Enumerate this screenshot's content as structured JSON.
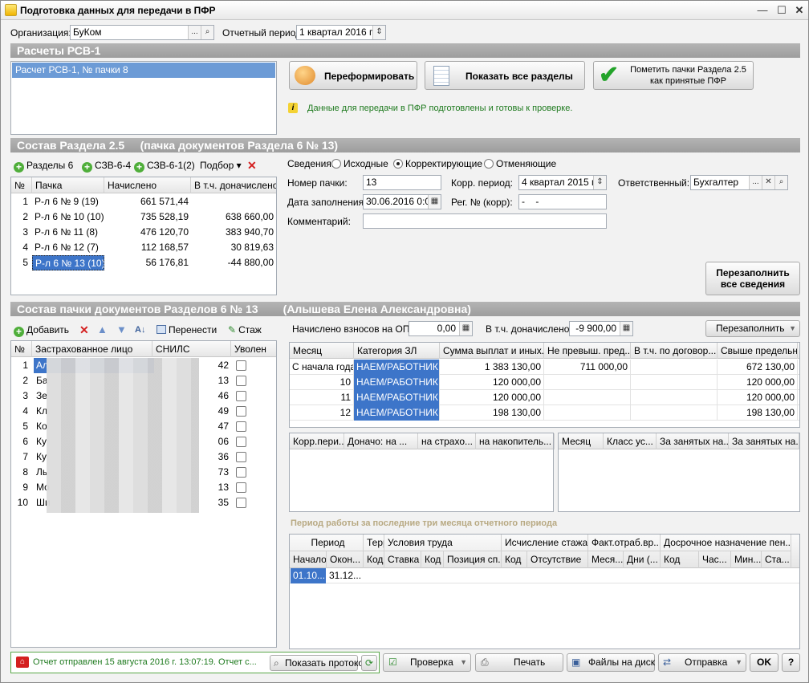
{
  "window": {
    "title": "Подготовка данных для передачи в ПФР"
  },
  "header": {
    "org_label": "Организация:",
    "org_value": "БуКом",
    "period_label": "Отчетный период:",
    "period_value": "1 квартал 2016 г."
  },
  "rsv": {
    "section_title": "Расчеты РСВ-1",
    "list_item": "Расчет РСВ-1, № пачки 8",
    "btn_reform": "Переформировать",
    "btn_show_all": "Показать все разделы",
    "btn_mark": "Пометить пачки Раздела 2.5 как принятые ПФР",
    "info_text": "Данные для передачи в ПФР подготовлены и готовы к проверке."
  },
  "section25": {
    "title": "Состав Раздела 2.5     (пачка документов Раздела 6 № 13)",
    "toolbar": {
      "razdely": "Разделы 6",
      "szv64": "СЗВ-6-4",
      "szv612": "СЗВ-6-1(2)",
      "podbor": "Подбор"
    },
    "columns": [
      "№",
      "Пачка",
      "Начислено",
      "В т.ч. доначислено"
    ],
    "rows": [
      {
        "n": "1",
        "pachka": "Р-л 6 № 9 (19)",
        "nach": "661 571,44",
        "don": ""
      },
      {
        "n": "2",
        "pachka": "Р-л 6 № 10 (10)",
        "nach": "735 528,19",
        "don": "638 660,00"
      },
      {
        "n": "3",
        "pachka": "Р-л 6 № 11 (8)",
        "nach": "476 120,70",
        "don": "383 940,70"
      },
      {
        "n": "4",
        "pachka": "Р-л 6 № 12 (7)",
        "nach": "112 168,57",
        "don": "30 819,63"
      },
      {
        "n": "5",
        "pachka": "Р-л 6 № 13 (10)",
        "nach": "56 176,81",
        "don": "-44 880,00"
      }
    ],
    "svedeniya_label": "Сведения:",
    "radio_options": [
      "Исходные",
      "Корректирующие",
      "Отменяющие"
    ],
    "nomer_label": "Номер пачки:",
    "nomer_value": "13",
    "korr_label": "Корр. период:",
    "korr_value": "4 квартал 2015 г.",
    "otv_label": "Ответственный:",
    "otv_value": "Бухгалтер",
    "date_label": "Дата заполнения:",
    "date_value": "30.06.2016  0:00",
    "reg_label": "Рег. № (корр):",
    "reg_value": "-    -",
    "comment_label": "Комментарий:",
    "comment_value": "",
    "btn_refill_all": "Перезаполнить все сведения"
  },
  "section6": {
    "title": "Состав пачки документов Разделов 6 № 13        (Алышева Елена Александровна)",
    "toolbar": {
      "add": "Добавить",
      "move": "Перенести",
      "stazh": "Стаж"
    },
    "columns": [
      "№",
      "Застрахованное лицо",
      "СНИЛС",
      "Уволен"
    ],
    "rows": [
      {
        "n": "1",
        "name": "Ал",
        "snils": "42"
      },
      {
        "n": "2",
        "name": "Ба",
        "snils": "13"
      },
      {
        "n": "3",
        "name": "Зе",
        "snils": "46"
      },
      {
        "n": "4",
        "name": "Кл",
        "snils": "49"
      },
      {
        "n": "5",
        "name": "Ко",
        "snils": "47"
      },
      {
        "n": "6",
        "name": "Ку",
        "snils": "06"
      },
      {
        "n": "7",
        "name": "Ку",
        "snils": "36"
      },
      {
        "n": "8",
        "name": "Ль",
        "snils": "73"
      },
      {
        "n": "9",
        "name": "Мо",
        "snils": "13"
      },
      {
        "n": "10",
        "name": "Ши",
        "snils": "35"
      }
    ],
    "ops_label": "Начислено взносов на ОПС:",
    "ops_value": "0,00",
    "don_label": "В т.ч. доначислено:",
    "don_value": "-9 900,00",
    "btn_refill": "Перезаполнить",
    "pay_columns": [
      "Месяц",
      "Категория ЗЛ",
      "Сумма выплат и иных...",
      "Не превыш. пред...",
      "В т.ч. по договор...",
      "Свыше предельн..."
    ],
    "pay_rows": [
      {
        "m": "С начала года",
        "cat": "НАЕМ/РАБОТНИК",
        "sum": "1 383 130,00",
        "np": "711 000,00",
        "dog": "",
        "sv": "672 130,00"
      },
      {
        "m": "10",
        "cat": "НАЕМ/РАБОТНИК",
        "sum": "120 000,00",
        "np": "",
        "dog": "",
        "sv": "120 000,00"
      },
      {
        "m": "11",
        "cat": "НАЕМ/РАБОТНИК",
        "sum": "120 000,00",
        "np": "",
        "dog": "",
        "sv": "120 000,00"
      },
      {
        "m": "12",
        "cat": "НАЕМ/РАБОТНИК",
        "sum": "198 130,00",
        "np": "",
        "dog": "",
        "sv": "198 130,00"
      }
    ],
    "korr_columns": [
      "Корр.пери...",
      "Доначо: на ...",
      "на страхо...",
      "на накопитель..."
    ],
    "month_columns": [
      "Месяц",
      "Класс ус...",
      "За занятых на...",
      "За занятых на..."
    ],
    "period_title": "Период работы за последние три месяца отчетного периода",
    "period_groups": [
      "Период",
      "Террито...",
      "Условия труда",
      "Исчисление стажа",
      "Факт.отраб.вр...",
      "Досрочное назначение пен..."
    ],
    "period_sub": [
      "Начало",
      "Окон...",
      "Код",
      "Ставка",
      "Код",
      "Позиция сп...",
      "Код",
      "Отсутствие",
      "Меся...",
      "Дни (...",
      "Код",
      "Час...",
      "Мин...",
      "Ста..."
    ],
    "period_row": {
      "start": "01.10...",
      "end": "31.12..."
    }
  },
  "footer": {
    "status_text": "Отчет отправлен 15 августа 2016 г. 13:07:19. Отчет с...",
    "btn_protocol": "Показать протокол",
    "btn_check": "Проверка",
    "btn_print": "Печать",
    "btn_files": "Файлы на диск",
    "btn_send": "Отправка",
    "btn_ok": "OK",
    "btn_help": "?"
  }
}
